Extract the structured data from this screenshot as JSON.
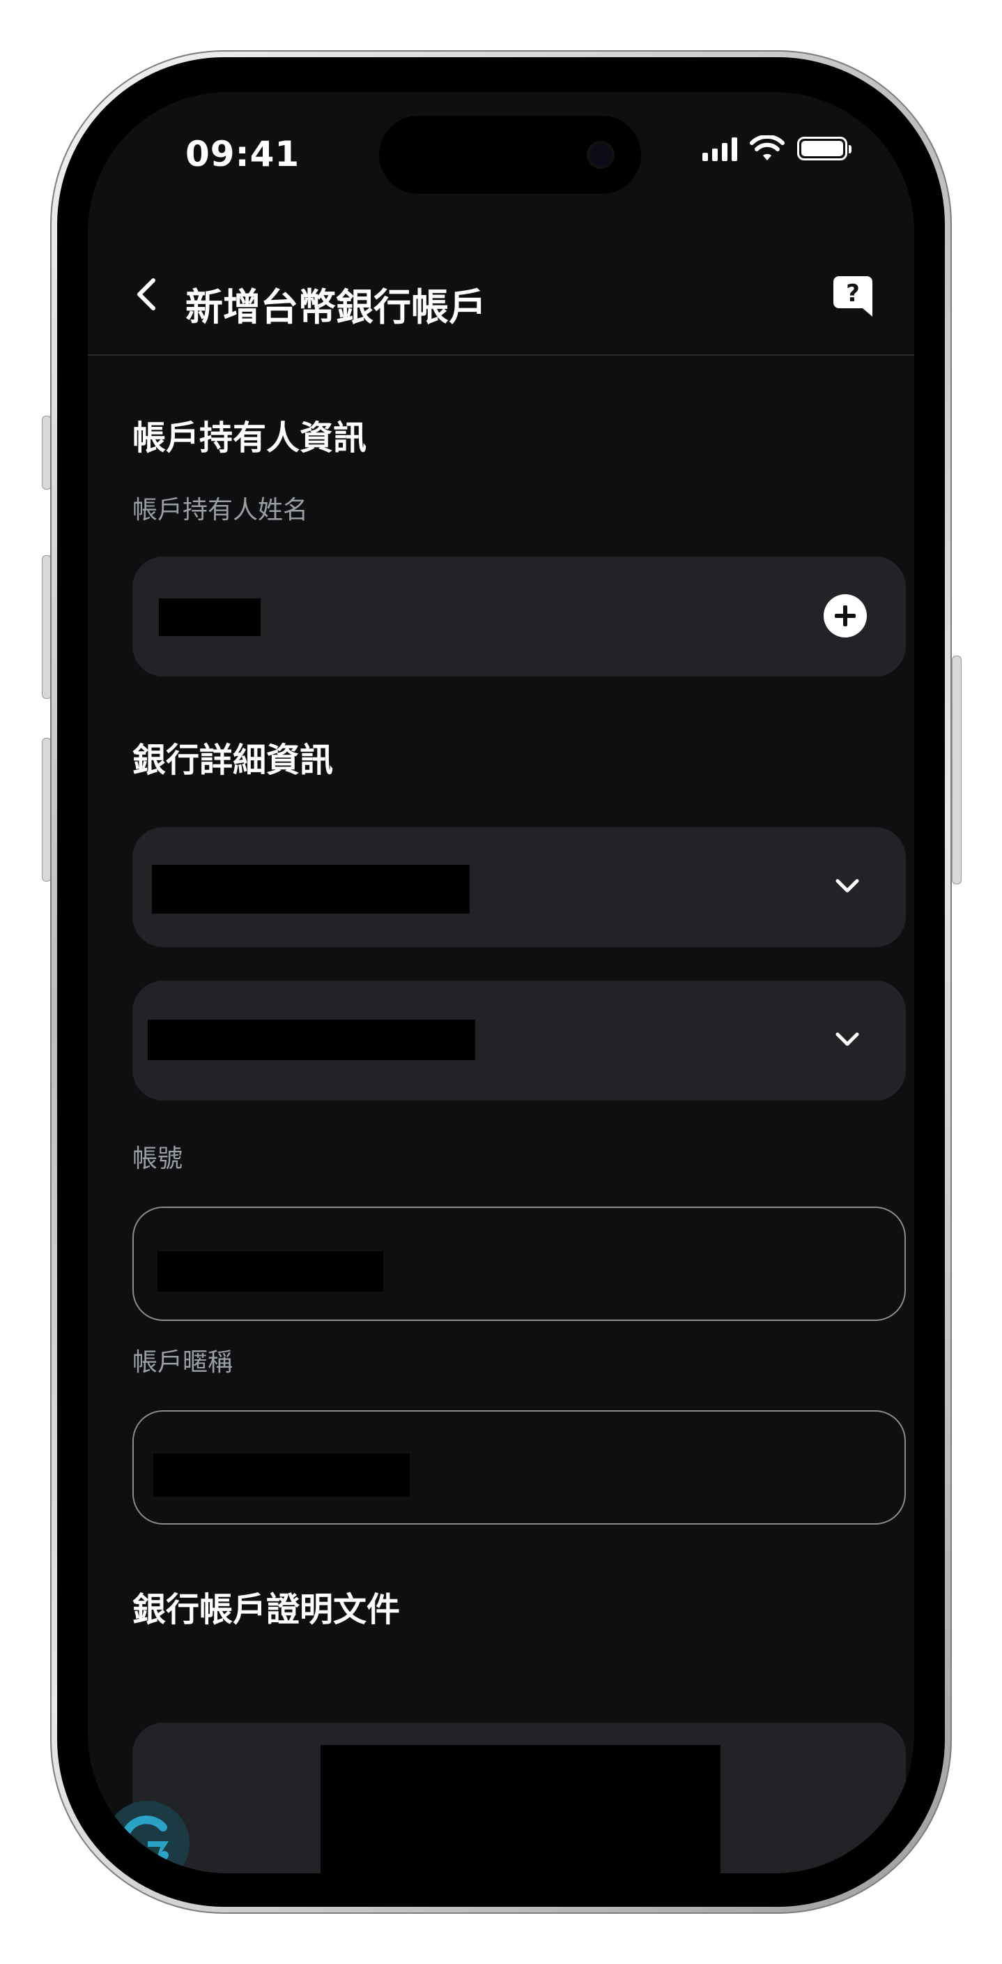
{
  "status_bar": {
    "time": "09:41"
  },
  "nav": {
    "title": "新增台幣銀行帳戶"
  },
  "holder_section": {
    "title": "帳戶持有人資訊",
    "name_label": "帳戶持有人姓名"
  },
  "bank_section": {
    "title": "銀行詳細資訊",
    "account_number_label": "帳號",
    "nickname_label": "帳戶暱稱"
  },
  "document_section": {
    "title": "銀行帳戶證明文件"
  },
  "icons": {
    "back": "chevron-left-icon",
    "help": "help-chat-icon",
    "add": "plus-circle-icon",
    "dropdown": "chevron-down-icon"
  },
  "colors": {
    "background": "#0e0f10",
    "field_fill": "#212326",
    "label": "#9b9ea3",
    "fab": "#1c3a44",
    "fab_accent": "#2aa3c4"
  }
}
